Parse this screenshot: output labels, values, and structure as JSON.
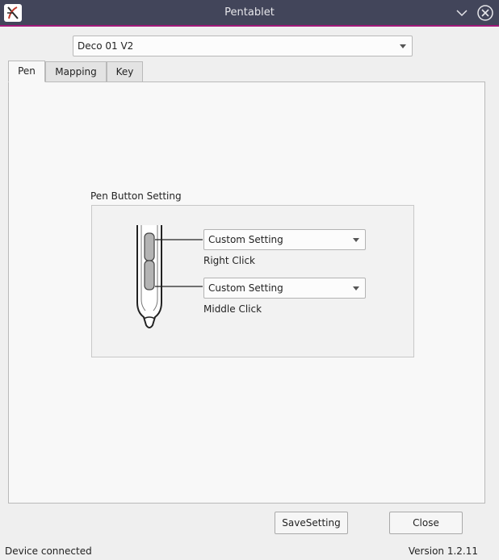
{
  "window": {
    "title": "Pentablet",
    "app_icon": "pentablet-logo-icon",
    "controls": [
      "chevron-down-icon",
      "close-icon"
    ]
  },
  "device": {
    "selected": "Deco 01 V2"
  },
  "tabs": [
    {
      "label": "Pen",
      "active": true
    },
    {
      "label": "Mapping",
      "active": false
    },
    {
      "label": "Key",
      "active": false
    }
  ],
  "pen_button": {
    "group_title": "Pen Button Setting",
    "buttons": [
      {
        "setting": "Custom Setting",
        "label": "Right Click"
      },
      {
        "setting": "Custom Setting",
        "label": "Middle Click"
      }
    ]
  },
  "actions": {
    "save_label": "SaveSetting",
    "close_label": "Close"
  },
  "status": {
    "text": "Device connected",
    "version": "Version 1.2.11"
  },
  "colors": {
    "titlebar": "#42455a",
    "titlebar_accent": "#a1197a",
    "background": "#efefef"
  }
}
